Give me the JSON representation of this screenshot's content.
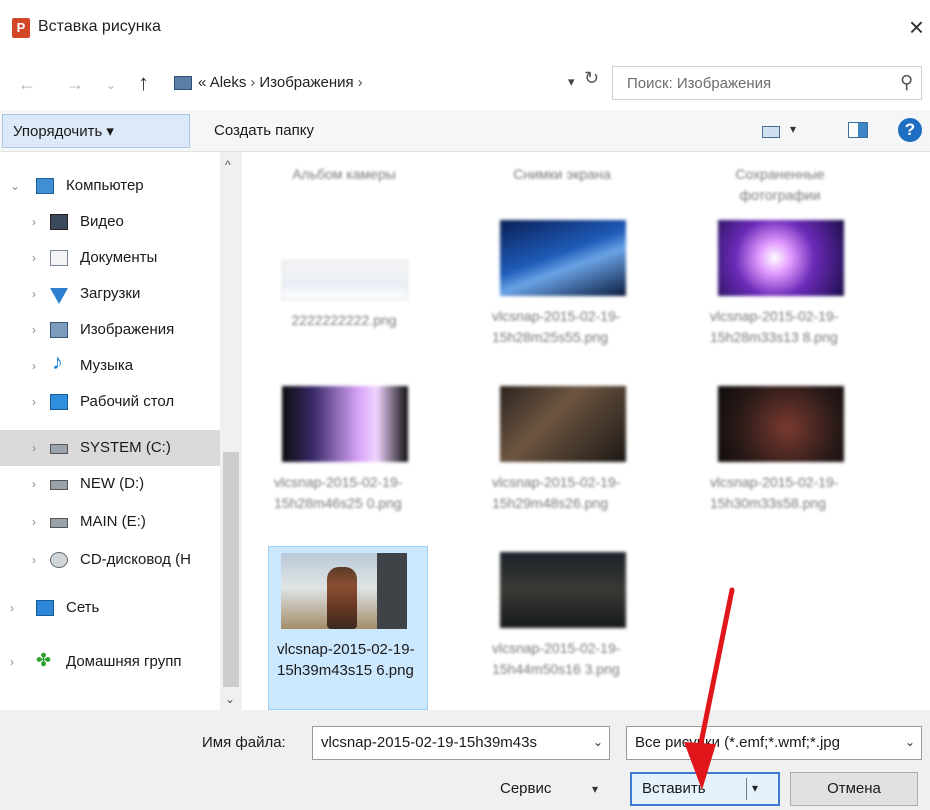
{
  "window": {
    "app_icon": "P",
    "title": "Вставка рисунка",
    "close_glyph": "×"
  },
  "address": {
    "prefix": "«",
    "crumbs": [
      "Aleks",
      "Изображения"
    ],
    "search_placeholder": "Поиск: Изображения"
  },
  "toolbar": {
    "organize": "Упорядочить ▾",
    "new_folder": "Создать папку",
    "help": "?"
  },
  "nav": {
    "items": [
      {
        "label": "Компьютер",
        "icon": "computer-icon"
      },
      {
        "label": "Видео",
        "icon": "video-folder-icon"
      },
      {
        "label": "Документы",
        "icon": "documents-folder-icon"
      },
      {
        "label": "Загрузки",
        "icon": "downloads-folder-icon"
      },
      {
        "label": "Изображения",
        "icon": "pictures-folder-icon"
      },
      {
        "label": "Музыка",
        "icon": "music-folder-icon"
      },
      {
        "label": "Рабочий стол",
        "icon": "desktop-folder-icon"
      },
      {
        "label": "SYSTEM (C:)",
        "icon": "system-drive-icon"
      },
      {
        "label": "NEW (D:)",
        "icon": "drive-icon"
      },
      {
        "label": "MAIN (E:)",
        "icon": "drive-icon"
      },
      {
        "label": "CD-дисковод (H",
        "icon": "cd-drive-icon"
      },
      {
        "label": "Сеть",
        "icon": "network-icon"
      },
      {
        "label": "Домашняя групп",
        "icon": "homegroup-icon"
      }
    ]
  },
  "files": [
    {
      "name": "Альбом камеры",
      "kind": "folder"
    },
    {
      "name": "Снимки экрана",
      "kind": "folder"
    },
    {
      "name": "Сохраненные фотографии",
      "kind": "folder"
    },
    {
      "name": "2222222222.png",
      "kind": "image"
    },
    {
      "name": "vlcsnap-2015-02-19-15h28m25s55.png",
      "kind": "image"
    },
    {
      "name": "vlcsnap-2015-02-19-15h28m33s13 8.png",
      "kind": "image"
    },
    {
      "name": "vlcsnap-2015-02-19-15h28m46s25 0.png",
      "kind": "image"
    },
    {
      "name": "vlcsnap-2015-02-19-15h29m48s26.png",
      "kind": "image"
    },
    {
      "name": "vlcsnap-2015-02-19-15h30m33s58.png",
      "kind": "image"
    },
    {
      "name": "vlcsnap-2015-02-19-15h39m43s15 6.png",
      "kind": "image",
      "selected": true
    },
    {
      "name": "vlcsnap-2015-02-19-15h44m50s16 3.png",
      "kind": "image"
    }
  ],
  "footer": {
    "filename_label": "Имя файла:",
    "filename_value": "vlcsnap-2015-02-19-15h39m43s",
    "filetype_value": "Все рисунки (*.emf;*.wmf;*.jpg",
    "tools": "Сервис",
    "insert": "Вставить",
    "cancel": "Отмена"
  },
  "colors": {
    "selection": "#cce8ff",
    "accent": "#3d7bd1",
    "annotation_arrow": "#e0161b"
  }
}
